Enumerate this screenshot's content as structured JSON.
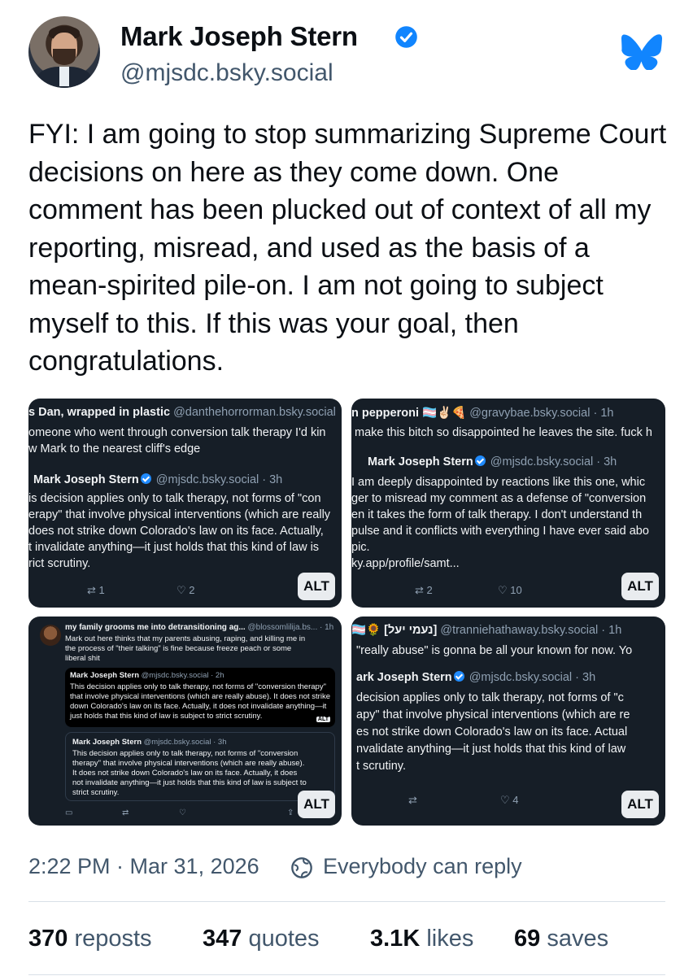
{
  "author": {
    "name": "Mark Joseph Stern",
    "handle": "@mjsdc.bsky.social",
    "verified": true
  },
  "brand_color": "#1185fe",
  "post": {
    "text": "FYI: I am going to stop summarizing Supreme Court decisions on here as they come down. One comment has been plucked out of context of all my reporting, misread, and used as the basis of a mean-spirited pile-on. I am not going to subject myself to this. If this was your goal, then congratulations."
  },
  "images": {
    "alt_label": "ALT",
    "tile1": {
      "author": "s Dan, wrapped in plastic",
      "handle": "@danthehorrorman.bsky.social",
      "lines": [
        "omeone who went through conversion talk therapy I'd kin",
        "w Mark to the nearest cliff's edge"
      ],
      "quote_author": "Mark Joseph Stern",
      "quote_meta": "@mjsdc.bsky.social · 3h",
      "quote_lines": [
        "is decision applies only to talk therapy, not forms of \"con",
        "erapy\" that involve physical interventions (which are really",
        "does not strike down Colorado's law on its face. Actually,",
        "t invalidate anything—it just holds that this kind of law is",
        "rict scrutiny."
      ],
      "reposts": "1",
      "likes": "2"
    },
    "tile2": {
      "author": "n pepperoni 🏳️‍⚧️✌🏻🍕",
      "handle": "@gravybae.bsky.social · 1h",
      "lines": [
        "make this bitch so disappointed he leaves the site. fuck h"
      ],
      "quote_author": "Mark Joseph Stern",
      "quote_meta": "@mjsdc.bsky.social · 3h",
      "quote_lines": [
        "I am deeply disappointed by reactions like this one, whic",
        "ger to misread my comment as a defense of \"conversion",
        "en it takes the form of talk therapy. I don't understand th",
        "pulse and it conflicts with everything I have ever said abo",
        "pic.",
        "ky.app/profile/samt..."
      ],
      "reposts": "2",
      "likes": "10"
    },
    "tile3": {
      "author": "my family grooms me into detransitioning ag...",
      "handle": "@blossomlilija.bs... · 1h",
      "lines": [
        "Mark out here thinks that my parents abusing, raping, and killing me in",
        "the process of \"their talking\" is fine because freeze peach or some",
        "liberal shit"
      ],
      "quote1_author": "Mark Joseph Stern",
      "quote1_meta": "@mjsdc.bsky.social · 2h",
      "quote1_lines": [
        "This decision applies only to talk therapy, not forms of \"conversion therapy\"",
        "that involve physical interventions (which are really abuse). It does not strike",
        "down Colorado's law on its face. Actually, it does not invalidate anything—it",
        "just holds that this kind of law is subject to strict scrutiny."
      ],
      "quote2_author": "Mark Joseph Stern",
      "quote2_meta": "@mjsdc.bsky.social · 3h",
      "quote2_lines": [
        "This decision applies only to talk therapy, not forms of \"conversion",
        "therapy\" that involve physical interventions (which are really abuse).",
        "It does not strike down Colorado's law on its face. Actually, it does",
        "not invalidate anything—it just holds that this kind of law is subject to",
        "strict scrutiny."
      ]
    },
    "tile4": {
      "author": "🏳️‍⚧️🌻 [נעמי יעל]",
      "handle": "@tranniehathaway.bsky.social · 1h",
      "lines": [
        "\"really abuse\" is gonna be all your known for now. Yo"
      ],
      "quote_author": "ark Joseph Stern",
      "quote_meta": "@mjsdc.bsky.social · 3h",
      "quote_lines": [
        "decision applies only to talk therapy, not forms of \"c",
        "apy\" that involve physical interventions (which are re",
        "es not strike down Colorado's law on its face. Actual",
        "nvalidate anything—it just holds that this kind of law",
        "t scrutiny."
      ],
      "likes": "4"
    }
  },
  "footer": {
    "timestamp": "2:22 PM · Mar 31, 2026",
    "reply_setting": "Everybody can reply",
    "reposts_count": "370",
    "reposts_label": "reposts",
    "quotes_count": "347",
    "quotes_label": "quotes",
    "likes_count": "3.1K",
    "likes_label": "likes",
    "saves_count": "69",
    "saves_label": "saves"
  }
}
